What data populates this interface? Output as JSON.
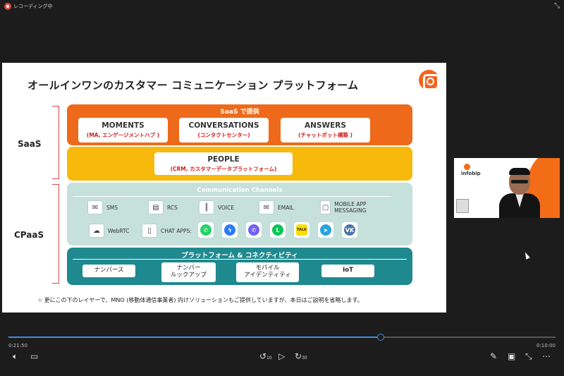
{
  "recording": {
    "label": "レコーディング中"
  },
  "slide": {
    "title": "オールインワンのカスタマー コミュニケーション プラットフォーム",
    "saas_label": "SaaS",
    "cpaas_label": "CPaaS",
    "saas_band": {
      "header": "SaaS で提供",
      "cards": [
        {
          "title": "MOMENTS",
          "sub": "(MA, エンゲージメントハブ )"
        },
        {
          "title": "CONVERSATIONS",
          "sub": "(コンタクトセンター)"
        },
        {
          "title": "ANSWERS",
          "sub": "(チャットボット構築 )"
        }
      ]
    },
    "people_band": {
      "title": "PEOPLE",
      "sub": "(CRM, カスタマーデータプラットフォーム)"
    },
    "channels_band": {
      "header": "Communication Channels",
      "channels": [
        {
          "label": "SMS",
          "icon": "sms-icon"
        },
        {
          "label": "RCS",
          "icon": "rcs-icon"
        },
        {
          "label": "VOICE",
          "icon": "voice-icon"
        },
        {
          "label": "EMAIL",
          "icon": "email-icon"
        },
        {
          "label": "MOBILE APP MESSAGING",
          "icon": "mobile-app-icon"
        },
        {
          "label": "WebRTC",
          "icon": "webrtc-icon"
        },
        {
          "label": "CHAT APPS:",
          "icon": "chat-apps-icon"
        }
      ],
      "apps": [
        {
          "name": "whatsapp-icon",
          "color": "#25d366",
          "glyph": "✆"
        },
        {
          "name": "messenger-icon",
          "color": "#2b7cf7",
          "glyph": "ϟ"
        },
        {
          "name": "viber-icon",
          "color": "#7360f2",
          "glyph": "✆"
        },
        {
          "name": "line-icon",
          "color": "#06c755",
          "glyph": "L"
        },
        {
          "name": "kakaotalk-icon",
          "color": "#f9e000",
          "glyph": "TALK"
        },
        {
          "name": "telegram-icon",
          "color": "#2aa3dc",
          "glyph": "➤"
        },
        {
          "name": "vk-icon",
          "color": "#4c75a3",
          "glyph": "VK"
        }
      ]
    },
    "platform_band": {
      "header": "プラットフォーム & コネクティビティ",
      "items": [
        "ナンバース",
        "ナンバー\nルックアップ",
        "モバイル\nアイデンティティ",
        "IoT"
      ]
    },
    "footnote": "☆ 更にこの下のレイヤーで、MNO (移動体通信事業者) 向けソリューションもご提供していますが、本日はご説明を省略します。"
  },
  "video": {
    "brand": "infobip"
  },
  "player": {
    "elapsed": "0:21:50",
    "remaining": "0:10:00",
    "progress": 0.68,
    "skip_back": "10",
    "skip_forward": "30"
  },
  "colors": {
    "accent": "#3e8ede",
    "brand_orange": "#ee6a1a",
    "yellow": "#f7b90c",
    "teal": "#1e8a8f"
  }
}
